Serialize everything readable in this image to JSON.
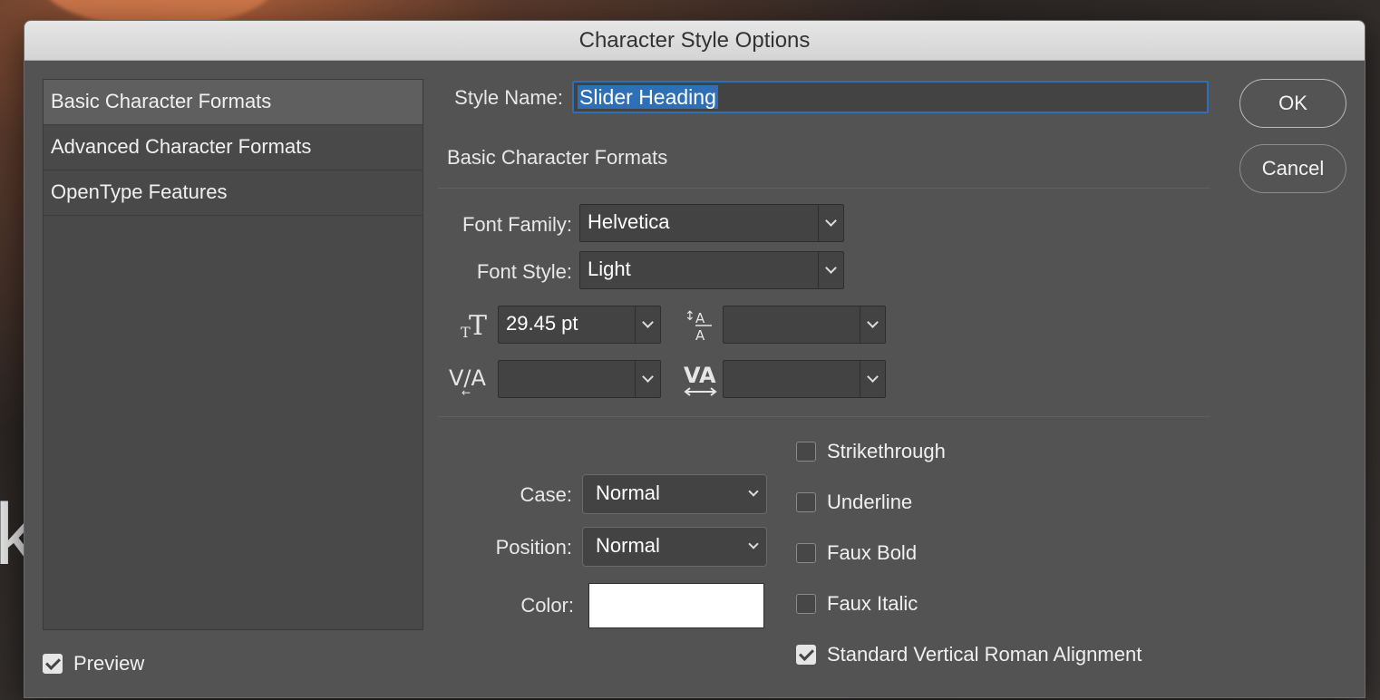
{
  "dialog": {
    "title": "Character Style Options"
  },
  "sidebar": {
    "items": [
      {
        "label": "Basic Character Formats",
        "active": true
      },
      {
        "label": "Advanced Character Formats",
        "active": false
      },
      {
        "label": "OpenType Features",
        "active": false
      }
    ]
  },
  "style_name": {
    "label": "Style Name:",
    "value": "Slider Heading"
  },
  "section": {
    "title": "Basic Character Formats"
  },
  "font_family": {
    "label": "Font Family:",
    "value": "Helvetica"
  },
  "font_style": {
    "label": "Font Style:",
    "value": "Light"
  },
  "font_size": {
    "value": "29.45 pt",
    "icon": "font-size-icon"
  },
  "leading": {
    "value": "",
    "icon": "leading-icon"
  },
  "kerning": {
    "value": "",
    "icon": "kerning-icon"
  },
  "tracking": {
    "value": "",
    "icon": "tracking-icon"
  },
  "case": {
    "label": "Case:",
    "value": "Normal"
  },
  "position": {
    "label": "Position:",
    "value": "Normal"
  },
  "color": {
    "label": "Color:",
    "swatch": "#ffffff"
  },
  "options": [
    {
      "label": "Strikethrough",
      "checked": false
    },
    {
      "label": "Underline",
      "checked": false
    },
    {
      "label": "Faux Bold",
      "checked": false
    },
    {
      "label": "Faux Italic",
      "checked": false
    },
    {
      "label": "Standard Vertical Roman Alignment",
      "checked": true
    }
  ],
  "preview": {
    "label": "Preview",
    "checked": true
  },
  "buttons": {
    "ok": "OK",
    "cancel": "Cancel"
  }
}
